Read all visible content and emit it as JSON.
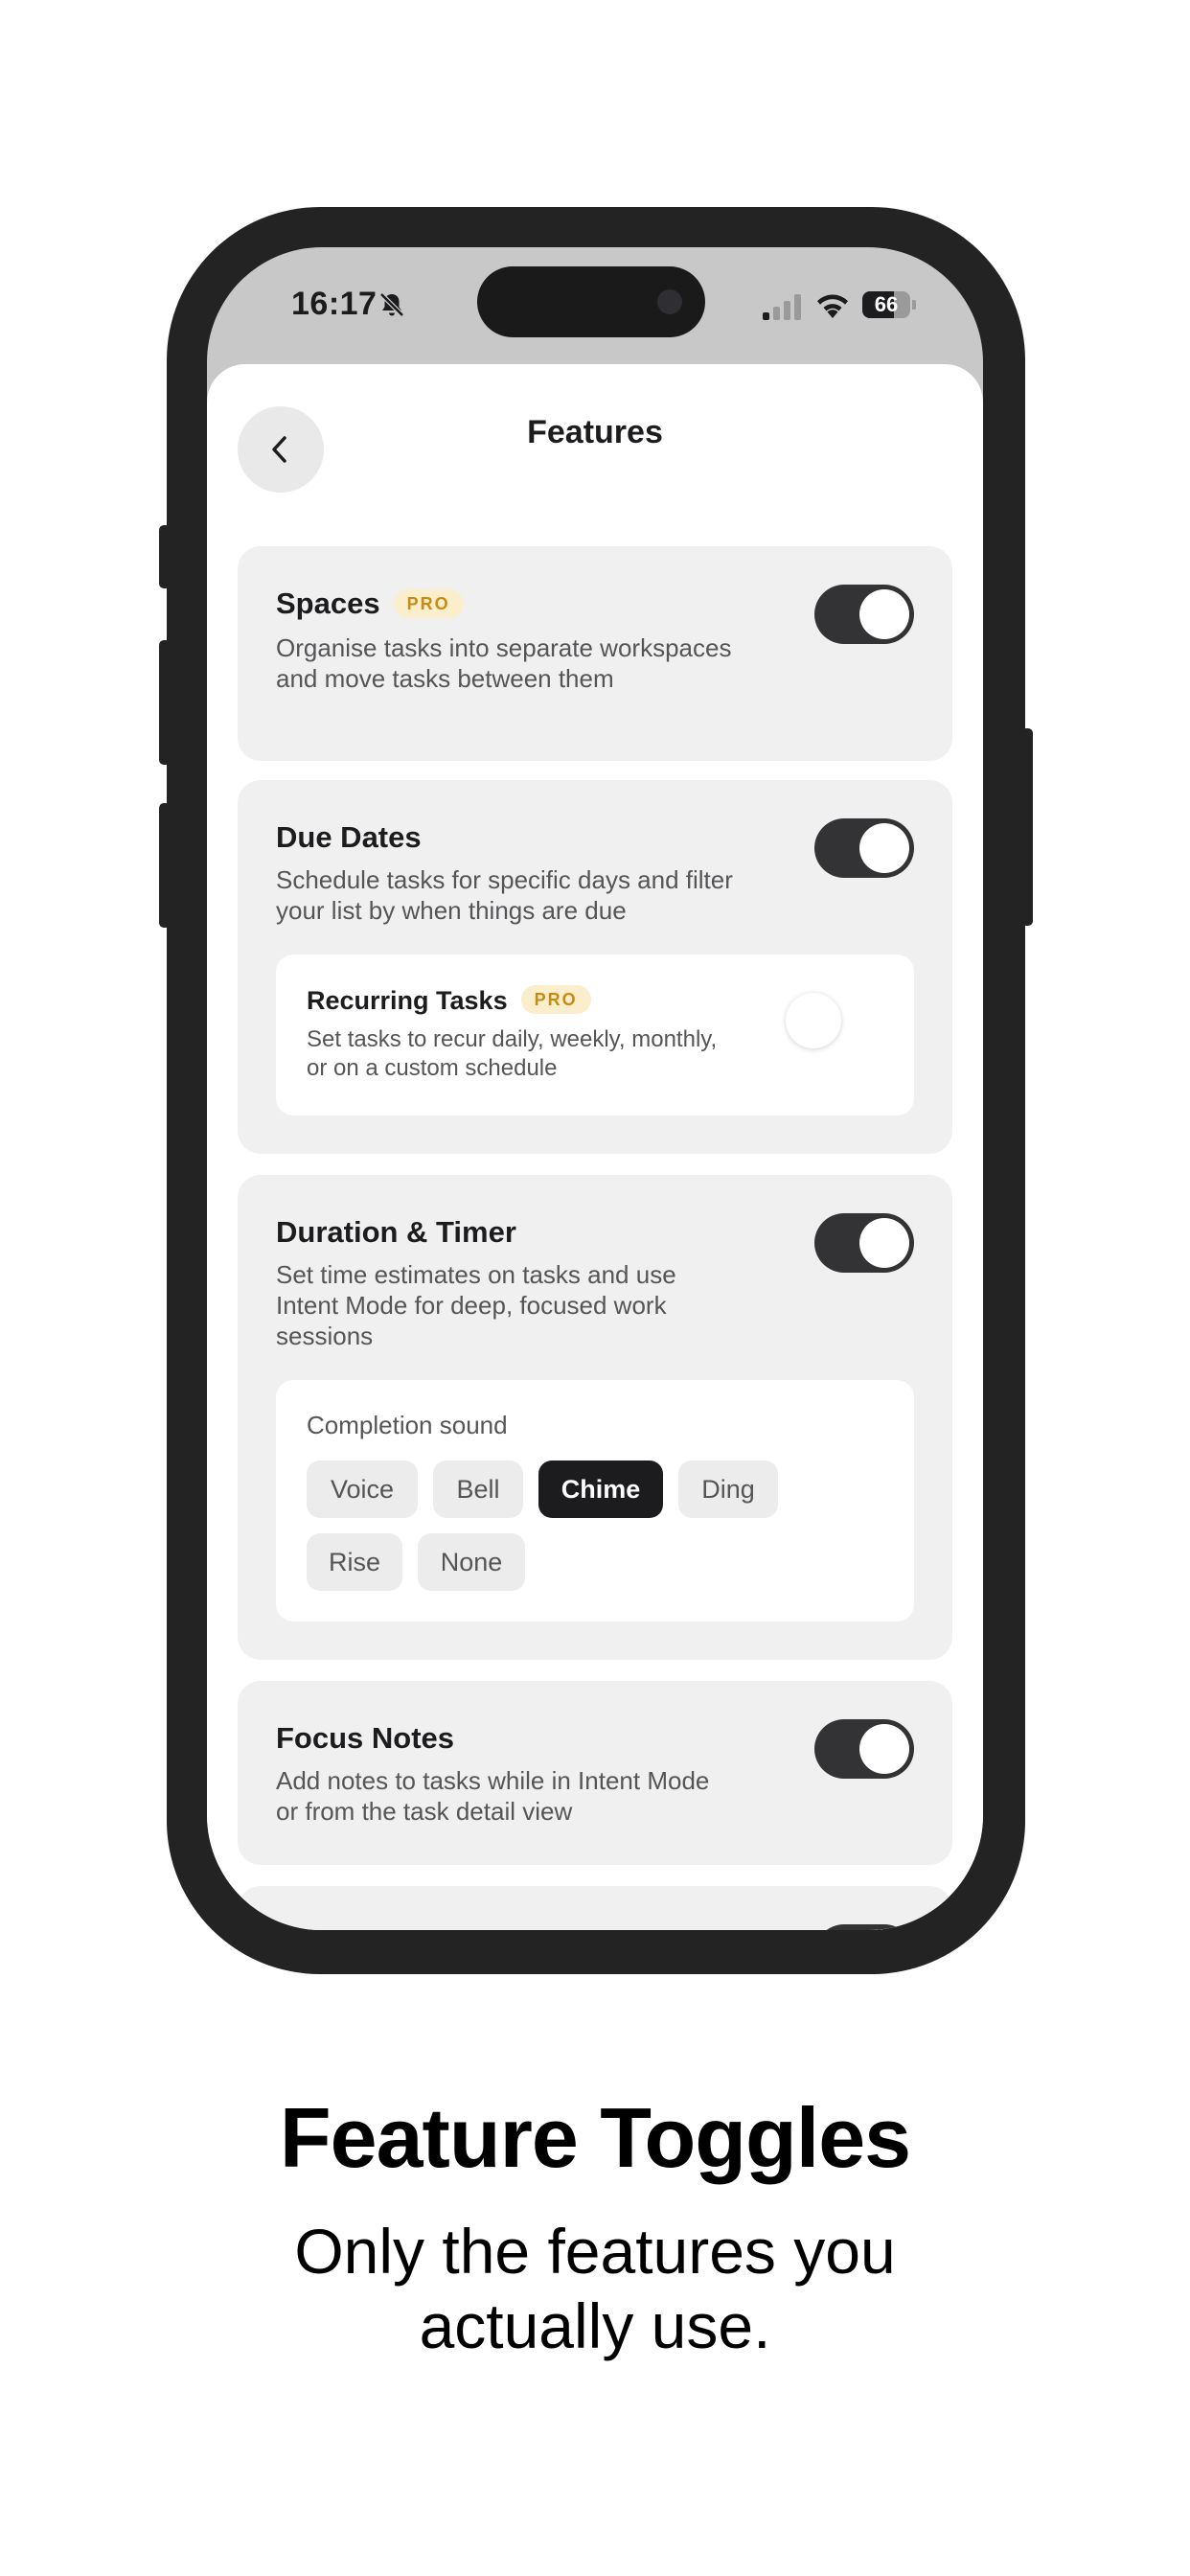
{
  "status_bar": {
    "time": "16:17",
    "battery_level": 66,
    "battery_text": "66",
    "silent_mode": true
  },
  "header": {
    "title": "Features",
    "back_icon": "chevron-left-icon"
  },
  "features": {
    "spaces": {
      "title": "Spaces",
      "badge": "PRO",
      "description": "Organise tasks into separate workspaces and move tasks between them",
      "enabled": true
    },
    "due_dates": {
      "title": "Due Dates",
      "description": "Schedule tasks for specific days and filter your list by when things are due",
      "enabled": true,
      "recurring": {
        "title": "Recurring Tasks",
        "badge": "PRO",
        "description": "Set tasks to recur daily, weekly, monthly, or on a custom schedule",
        "enabled": false
      }
    },
    "duration_timer": {
      "title": "Duration & Timer",
      "description": "Set time estimates on tasks and use Intent Mode for deep, focused work sessions",
      "enabled": true,
      "completion_sound": {
        "label": "Completion sound",
        "options": [
          "Voice",
          "Bell",
          "Chime",
          "Ding",
          "Rise",
          "None"
        ],
        "selected": "Chime"
      }
    },
    "focus_notes": {
      "title": "Focus Notes",
      "description": "Add notes to tasks while in Intent Mode or from the task detail view",
      "enabled": true
    },
    "partial_next": {
      "enabled": true
    }
  },
  "marketing": {
    "headline": "Feature Toggles",
    "subheadline": "Only the features you actually use."
  },
  "colors": {
    "toggle_on": "#333335",
    "pro_badge_bg": "#fbeecd",
    "pro_badge_text": "#c98a12",
    "card_bg": "#f0f0f0",
    "chip_selected": "#1c1c1e"
  }
}
